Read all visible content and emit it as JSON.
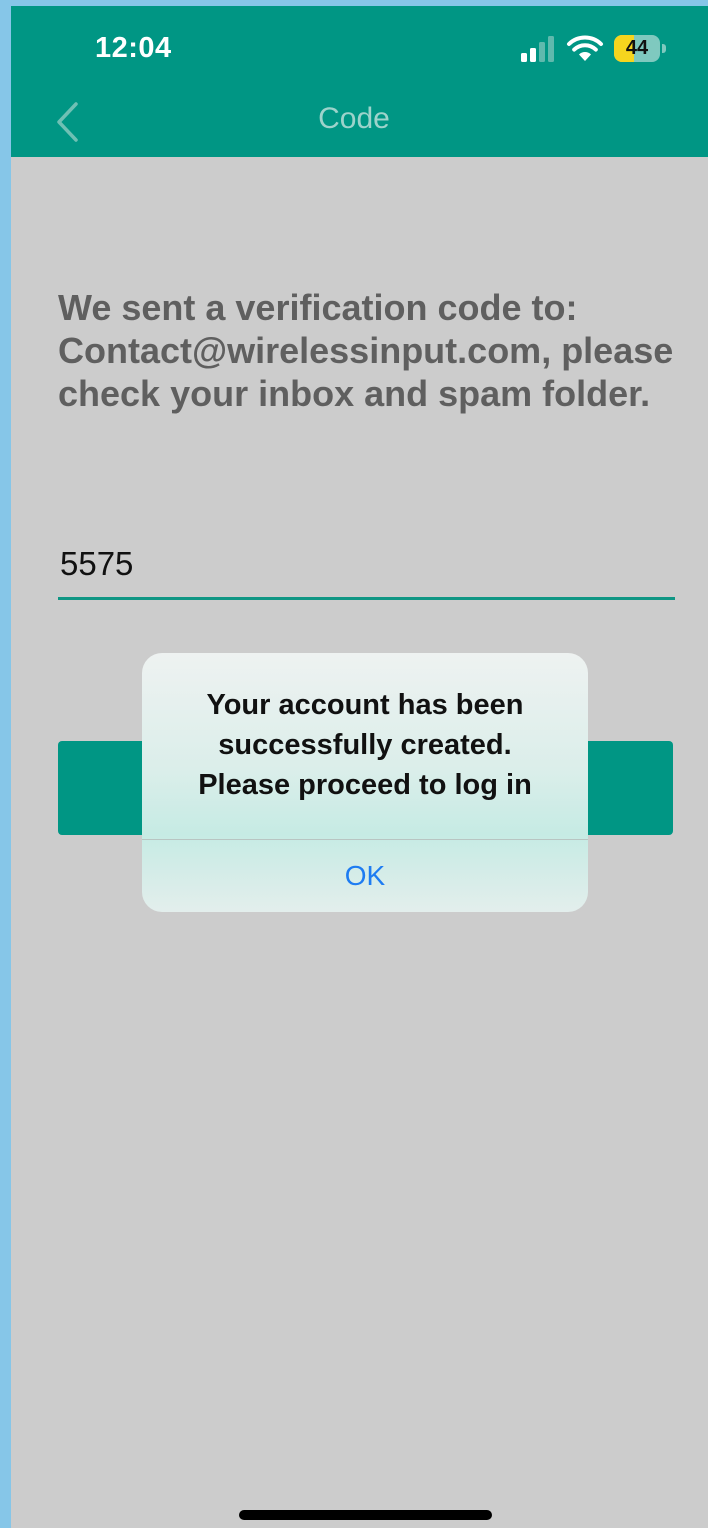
{
  "status_bar": {
    "time": "12:04",
    "battery_level": "44",
    "battery_fraction": 0.44,
    "icons": [
      "signal-icon",
      "wifi-icon",
      "battery-icon"
    ]
  },
  "nav": {
    "title": "Code",
    "back_icon": "chevron-left-icon"
  },
  "main": {
    "message": "We sent a verification code to: Contact@wirelessinput.com, please check your inbox and spam folder.",
    "code_value": "5575"
  },
  "alert": {
    "message": "Your account has been\nsuccessfully created.\nPlease proceed to log in",
    "ok_label": "OK"
  },
  "colors": {
    "header": "#009684",
    "background": "#cccccc",
    "accent": "#009684",
    "link": "#1e7cf2"
  }
}
